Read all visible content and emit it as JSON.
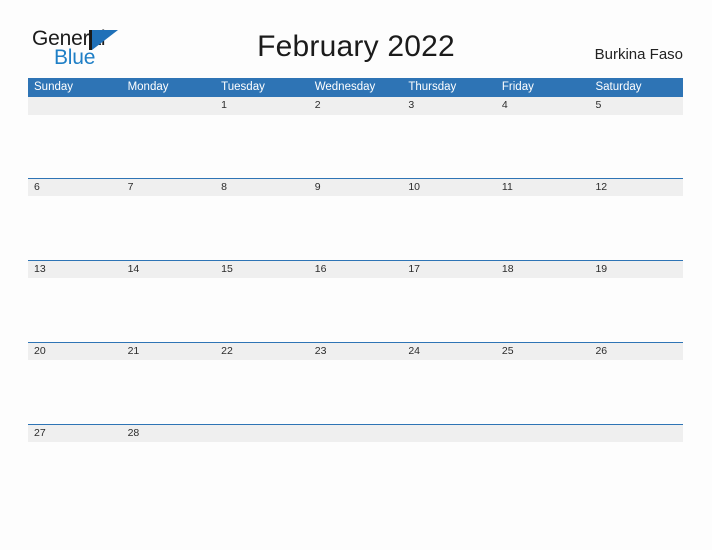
{
  "brand": {
    "name_part1": "General",
    "name_part2": "Blue",
    "triangle_color": "#1f70b8",
    "blue_text_color": "#1f7fc6"
  },
  "header": {
    "title": "February 2022",
    "locale": "Burkina Faso",
    "accent_color": "#2e74b5",
    "row_band_color": "#efefef"
  },
  "calendar": {
    "month": "February",
    "year": "2022",
    "weekdays": [
      "Sunday",
      "Monday",
      "Tuesday",
      "Wednesday",
      "Thursday",
      "Friday",
      "Saturday"
    ],
    "weeks": [
      [
        "",
        "",
        "1",
        "2",
        "3",
        "4",
        "5"
      ],
      [
        "6",
        "7",
        "8",
        "9",
        "10",
        "11",
        "12"
      ],
      [
        "13",
        "14",
        "15",
        "16",
        "17",
        "18",
        "19"
      ],
      [
        "20",
        "21",
        "22",
        "23",
        "24",
        "25",
        "26"
      ],
      [
        "27",
        "28",
        "",
        "",
        "",
        "",
        ""
      ]
    ]
  }
}
